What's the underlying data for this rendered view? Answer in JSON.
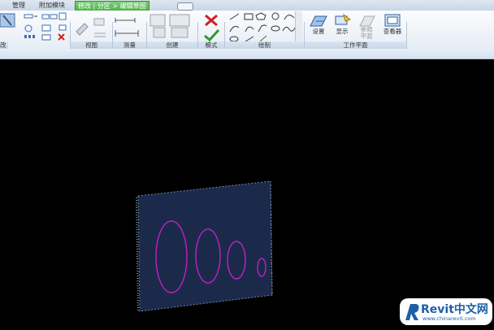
{
  "tabs": [
    {
      "label": "管理"
    },
    {
      "label": "附加模块"
    },
    {
      "label": "修改 | 分区 > 编辑草图",
      "active": true
    }
  ],
  "panels": {
    "left_stub": "改",
    "view": "视图",
    "measure": "测量",
    "create": "创建",
    "mode": "模式",
    "draw": "绘制",
    "workplane": "工作平面"
  },
  "workplane_buttons": {
    "set": "设置",
    "show": "显示",
    "ref_plane": "参照\n平面",
    "viewer": "查看器"
  },
  "watermark": {
    "brand": "Revit中文网",
    "url": "www.chinarevit.com"
  },
  "colors": {
    "panel_fill": "#1b2a4a",
    "ellipse_stroke": "#c020c0",
    "edge": "#6f8aa3",
    "cancel": "#d02020",
    "finish": "#2e9a2e"
  }
}
